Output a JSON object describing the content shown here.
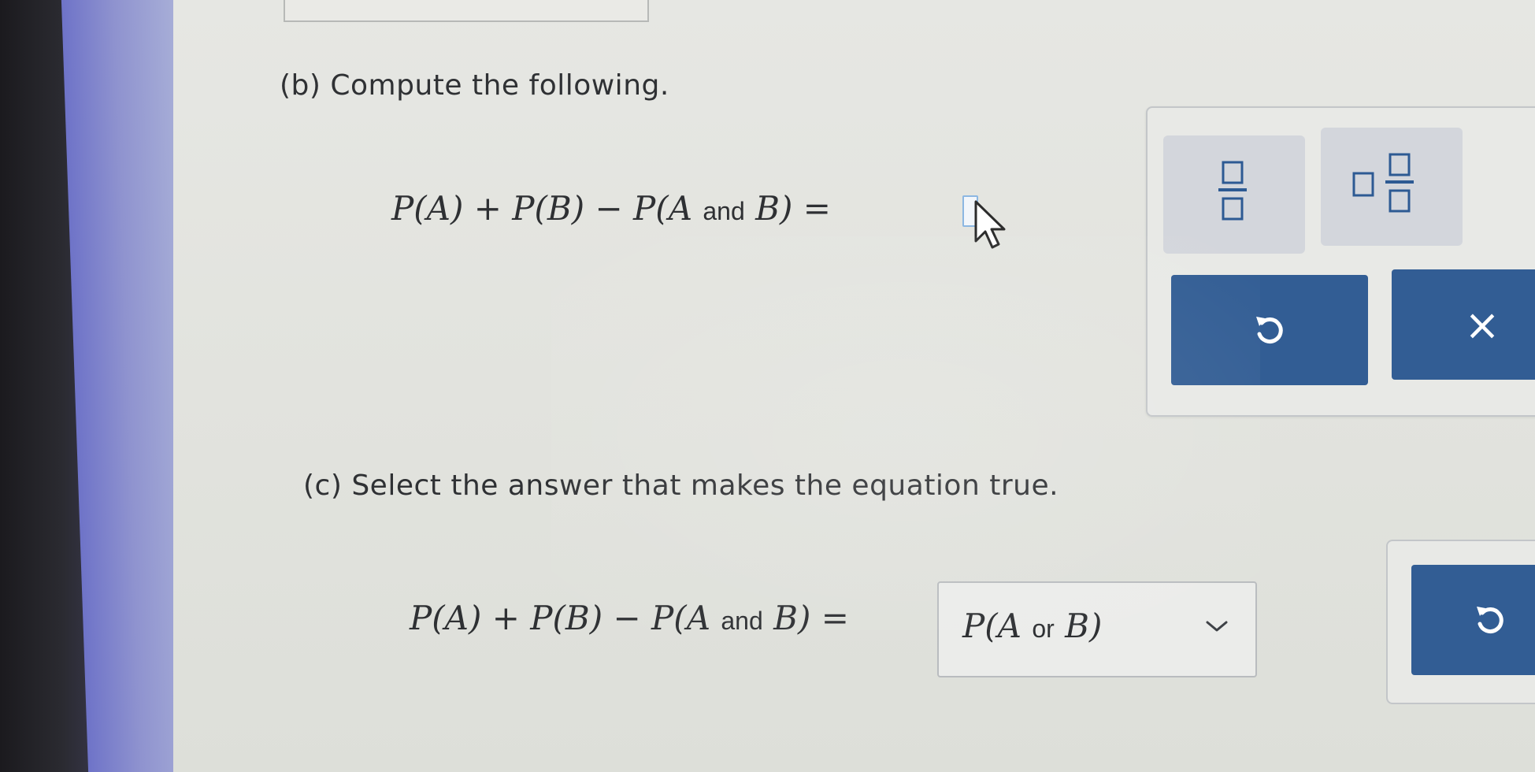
{
  "part_b": {
    "heading": "(b) Compute the following.",
    "expression": {
      "lhs_start": "P(A) + P(B) − P(A ",
      "and_word": "and",
      "lhs_end": " B) ="
    },
    "answer_value": ""
  },
  "palette_b": {
    "icons": [
      "fraction-icon",
      "mixed-number-icon",
      "undo-icon",
      "clear-icon"
    ],
    "clear_label": "×"
  },
  "part_c": {
    "heading": "(c) Select the answer that makes the equation true.",
    "expression": {
      "lhs_start": "P(A) + P(B) − P(A ",
      "and_word": "and",
      "lhs_end": " B) ="
    },
    "dropdown": {
      "selected_start": "P(A ",
      "selected_or": "or",
      "selected_end": " B)"
    }
  },
  "colors": {
    "accent_button": "#325d94",
    "palette_button": "#d3d6dc",
    "input_border": "#8cb7e2"
  }
}
